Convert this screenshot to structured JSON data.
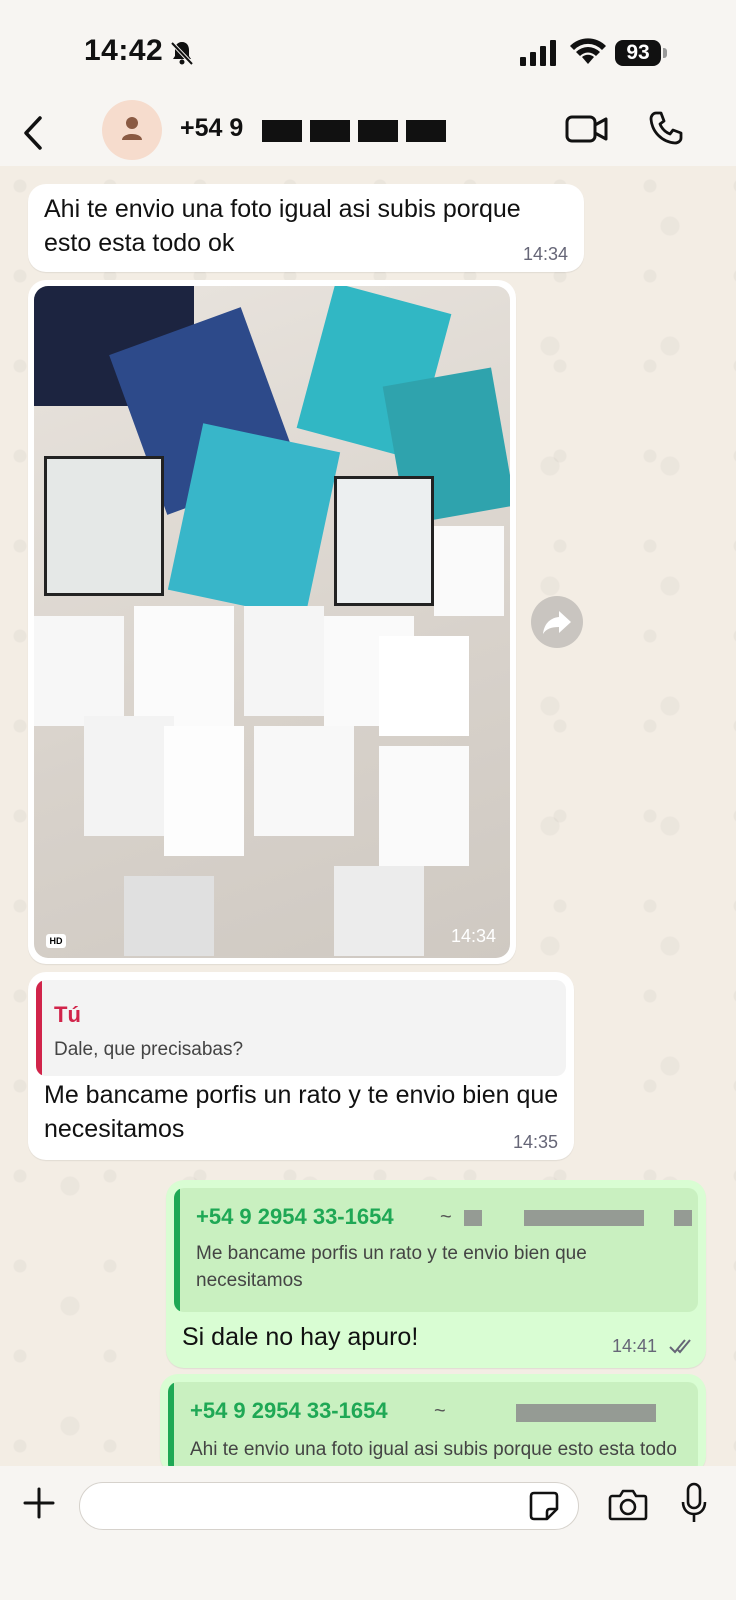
{
  "status_bar": {
    "time": "14:42",
    "battery": "93"
  },
  "header": {
    "contact": "+54 9"
  },
  "messages": {
    "m1": {
      "text": "Ahi te envio una foto igual asi subis porque esto esta todo ok",
      "time": "14:34"
    },
    "photo": {
      "time": "14:34",
      "badge": "HD"
    },
    "m3": {
      "quote_name": "Tú",
      "quote_text": "Dale, que precisabas?",
      "text": "Me bancame porfis un rato y te envio bien que necesitamos",
      "time": "14:35"
    },
    "m4": {
      "quote_name": "+54 9 2954 33-1654",
      "quote_sep": "~",
      "quote_text": "Me bancame porfis un rato y te envio bien que necesitamos",
      "text": "Si dale no hay apuro!",
      "time": "14:41"
    },
    "m5": {
      "quote_name": "+54 9 2954 33-1654",
      "quote_sep": "~",
      "quote_text": "Ahi te envio una foto igual asi subis porque esto esta todo ok"
    }
  },
  "colors": {
    "out_bubble": "#d9fdd3",
    "out_quote_accent": "#1fa855",
    "in_quote_accent": "#d1244a"
  },
  "icons": [
    "back-icon",
    "avatar-person-icon",
    "video-call-icon",
    "phone-icon",
    "forward-icon",
    "plus-icon",
    "sticker-icon",
    "camera-icon",
    "mic-icon",
    "read-receipt-icon"
  ]
}
